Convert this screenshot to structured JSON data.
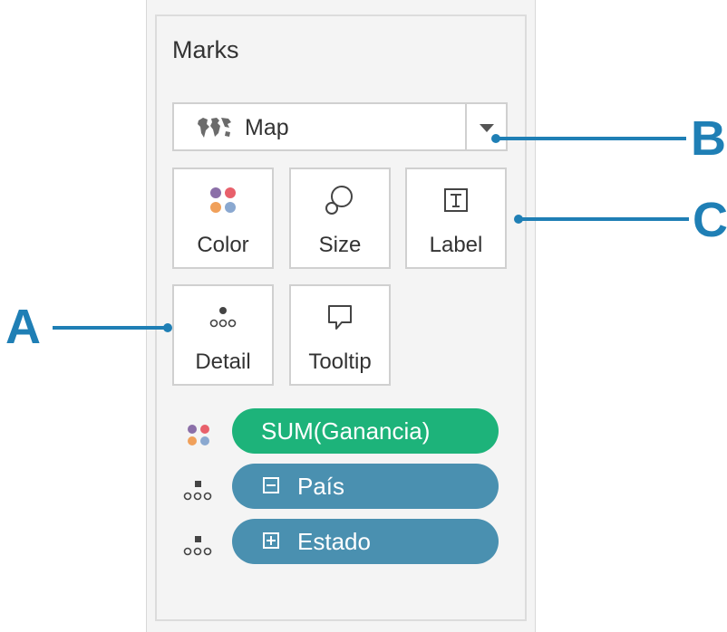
{
  "marks_card": {
    "title": "Marks",
    "mark_type": {
      "icon": "map-globe-icon",
      "label": "Map"
    },
    "buttons": [
      {
        "id": "color",
        "label": "Color",
        "icon": "color-dots-icon"
      },
      {
        "id": "size",
        "label": "Size",
        "icon": "size-circles-icon"
      },
      {
        "id": "label",
        "label": "Label",
        "icon": "text-label-icon"
      },
      {
        "id": "detail",
        "label": "Detail",
        "icon": "detail-dots-icon"
      },
      {
        "id": "tooltip",
        "label": "Tooltip",
        "icon": "tooltip-bubble-icon"
      }
    ],
    "fields": [
      {
        "encoding": "color",
        "label": "SUM(Ganancia)",
        "color": "#1db37a"
      },
      {
        "encoding": "detail",
        "label": "País",
        "expand": "collapse",
        "color": "#4a90b0"
      },
      {
        "encoding": "detail",
        "label": "Estado",
        "expand": "expand",
        "color": "#4a90b0"
      }
    ]
  },
  "callouts": [
    {
      "letter": "A"
    },
    {
      "letter": "B"
    },
    {
      "letter": "C"
    }
  ],
  "colors": {
    "callout": "#1f7fb5",
    "dot_purple": "#8b6fa8",
    "dot_red": "#e8606b",
    "dot_orange": "#f0a05a",
    "dot_blue": "#8aa8d0"
  }
}
